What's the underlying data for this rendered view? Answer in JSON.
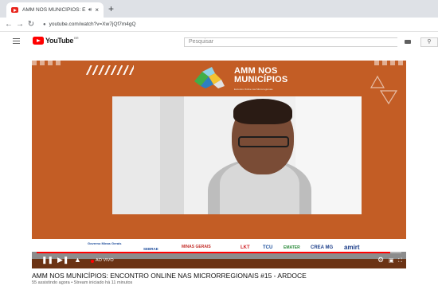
{
  "browser": {
    "tab_title": "AMM NOS MUNICÍPIOS: EN",
    "tab_audio_icon": "speaker-icon",
    "tab_close": "×",
    "new_tab": "+",
    "url": "youtube.com/watch?v=Xw7jQf7m4gQ"
  },
  "youtube": {
    "logo_text": "YouTube",
    "logo_region": "BR",
    "search_placeholder": "Pesquisar",
    "brand_red": "#ff0000"
  },
  "video": {
    "overlay_title_line1": "AMM NOS",
    "overlay_title_line2": "MUNICÍPIOS",
    "overlay_tagline": "Encontro Online nas Microrregionais",
    "background_color": "#c35d25",
    "sponsors": [
      "Governo Minas Gerais",
      "AO VIVO",
      "SEBRAE",
      "MINAS GERAIS",
      "LKT",
      "TCU",
      "EMATER",
      "CREA MG",
      "amirt"
    ],
    "live_label": "AO VIVO",
    "progress_fraction": 0.97
  },
  "info": {
    "title": "AMM NOS MUNICÍPIOS: ENCONTRO ONLINE NAS MICRORREGIONAIS #15 - ARDOCE",
    "meta": "55 assistindo agora • Stream iniciado há 11 minutos"
  }
}
